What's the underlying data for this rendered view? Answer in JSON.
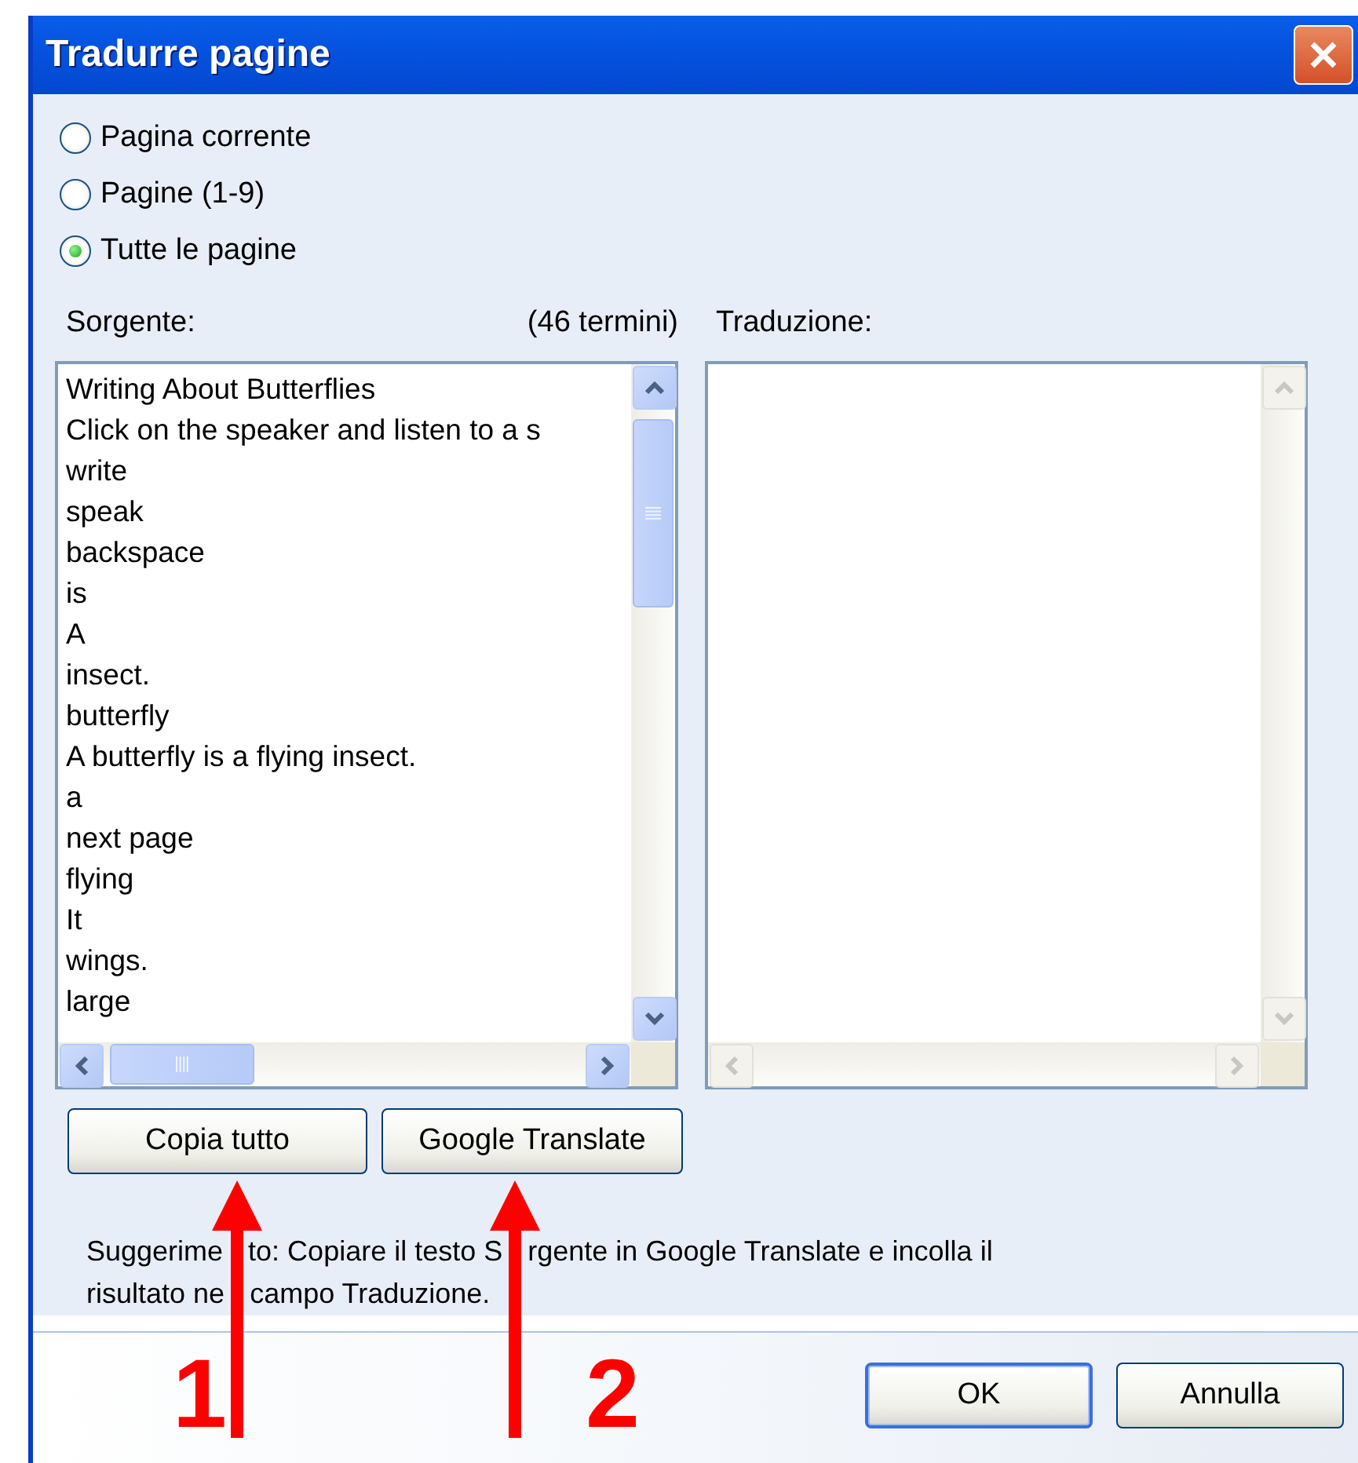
{
  "window": {
    "title": "Tradurre pagine"
  },
  "scope_options": [
    {
      "label": "Pagina corrente",
      "selected": false
    },
    {
      "label": "Pagine (1-9)",
      "selected": false
    },
    {
      "label": "Tutte le pagine",
      "selected": true
    }
  ],
  "source": {
    "label": "Sorgente:",
    "count": "(46 termini)",
    "items": [
      "Writing About Butterflies",
      "Click on the speaker and listen to a s",
      "write",
      "speak",
      "backspace",
      "is",
      "A",
      "insect.",
      "butterfly",
      "A butterfly is a flying insect.",
      "a",
      "next page",
      "flying",
      "It",
      "wings.",
      "large"
    ]
  },
  "translation": {
    "label": "Traduzione:"
  },
  "buttons": [
    "Copia tutto",
    "Google Translate"
  ],
  "hint": {
    "lines": [
      [
        "Suggerime",
        "to: Copiare il testo S",
        "rgente in Google Translate e incolla il"
      ],
      [
        "risultato ne",
        "campo Traduzione."
      ]
    ]
  },
  "dialog_buttons": [
    {
      "label": "OK",
      "default": true
    },
    {
      "label": "Annulla",
      "default": false
    }
  ],
  "annotations": [
    {
      "label": "1"
    },
    {
      "label": "2"
    }
  ]
}
